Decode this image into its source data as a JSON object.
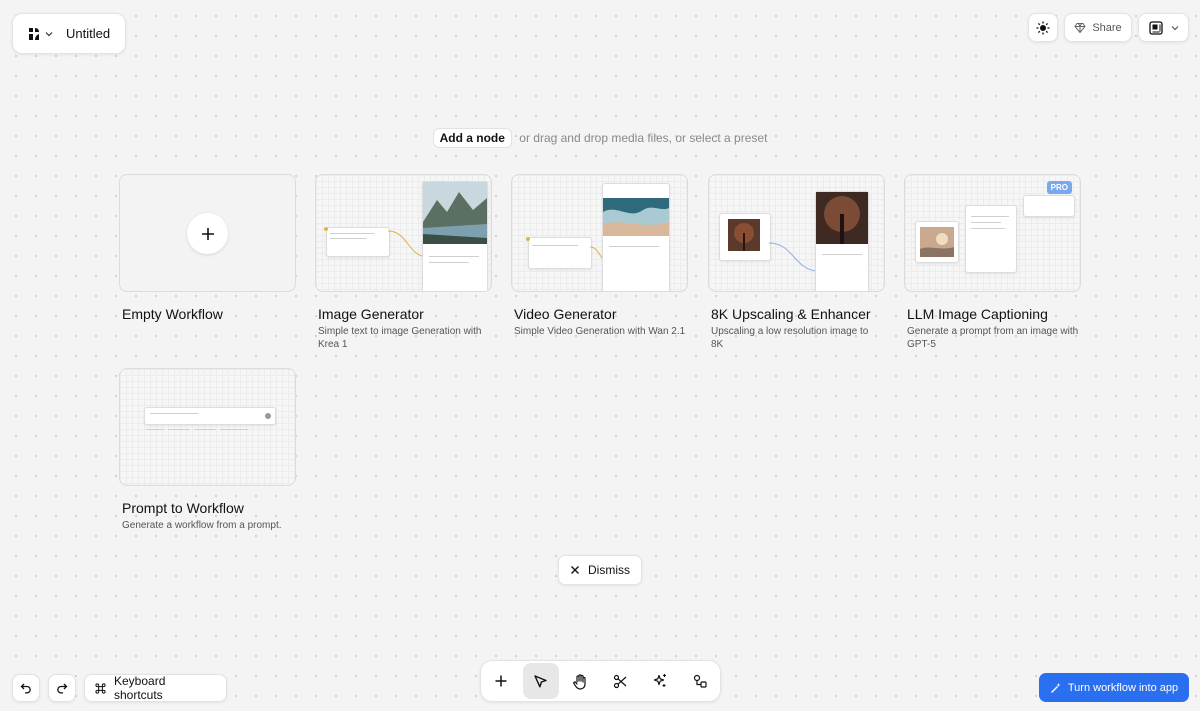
{
  "header": {
    "doc_title": "Untitled",
    "share_label": "Share"
  },
  "hint": {
    "add_node": "Add a node",
    "rest": "or drag and drop media files, or select a preset"
  },
  "presets": [
    {
      "title": "Empty Workflow",
      "desc": ""
    },
    {
      "title": "Image Generator",
      "desc": "Simple text to image Generation with Krea 1"
    },
    {
      "title": "Video Generator",
      "desc": "Simple Video Generation with Wan 2.1"
    },
    {
      "title": "8K Upscaling & Enhancer",
      "desc": "Upscaling a low resolution image to 8K"
    },
    {
      "title": "LLM Image Captioning",
      "desc": "Generate a prompt from an image with GPT-5",
      "badge": "PRO"
    },
    {
      "title": "Prompt to Workflow",
      "desc": "Generate a workflow from a prompt."
    }
  ],
  "dismiss_label": "Dismiss",
  "footer": {
    "keyboard_shortcuts": "Keyboard shortcuts",
    "turn_into_app": "Turn workflow into app"
  },
  "colors": {
    "accent": "#2a6ff0",
    "pro_badge": "#7aa8ef",
    "background": "#f4f4f4"
  },
  "icons": [
    "krea-logo-icon",
    "chevron-down-icon",
    "sun-icon",
    "gem-icon",
    "layout-view-icon",
    "plus-icon",
    "close-icon",
    "undo-icon",
    "redo-icon",
    "command-icon",
    "cursor-icon",
    "hand-icon",
    "scissors-icon",
    "sparkle-icon",
    "nodes-icon",
    "wand-icon"
  ]
}
